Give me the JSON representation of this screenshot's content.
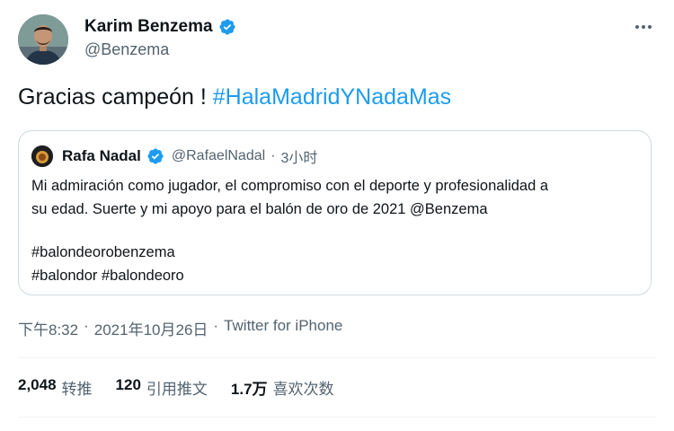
{
  "author": {
    "name": "Karim Benzema",
    "handle": "@Benzema",
    "verified": true
  },
  "tweet": {
    "text": "Gracias campeón ! ",
    "hashtag": "#HalaMadridYNadaMas"
  },
  "quote": {
    "name": "Rafa Nadal",
    "handle": "@RafaelNadal",
    "separator": "·",
    "time": "3小时",
    "lines": [
      "Mi admiración como jugador, el compromiso con el deporte y profesionalidad a",
      "su edad. Suerte y mi apoyo para el balón de oro de 2021 @Benzema",
      "#balondeorobenzema",
      "#balondor #balondeoro"
    ]
  },
  "meta": {
    "time": "下午8:32",
    "date": "2021年10月26日",
    "separator1": "·",
    "separator2": "·",
    "source": "Twitter for iPhone"
  },
  "stats": {
    "retweets_count": "2,048",
    "retweets_label": "转推",
    "quotes_count": "120",
    "quotes_label": "引用推文",
    "likes_count": "1.7万",
    "likes_label": "喜欢次数"
  },
  "colors": {
    "accent": "#1d9bf0",
    "text": "#0f1419",
    "secondary": "#536471",
    "border": "#cfd9de"
  },
  "icons": {
    "verified": "verified-badge-icon",
    "more": "more-options-icon"
  }
}
